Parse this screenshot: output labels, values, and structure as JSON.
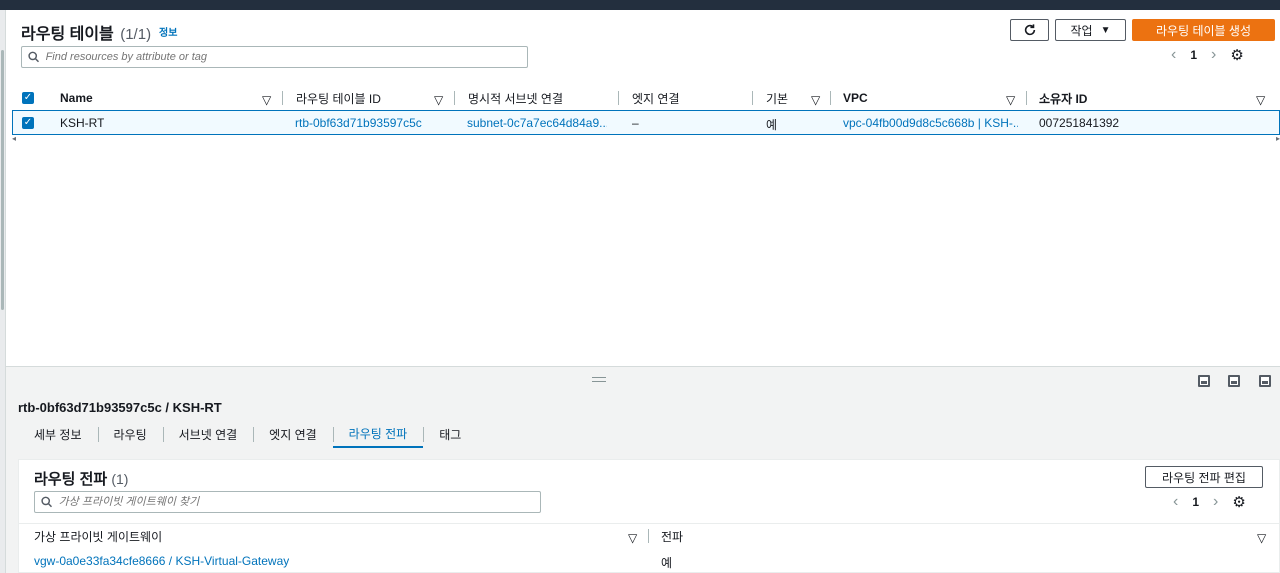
{
  "upper": {
    "title": "라우팅 테이블",
    "count": "(1/1)",
    "info": "정보",
    "actions_label": "작업",
    "create_label": "라우팅 테이블 생성",
    "search_placeholder": "Find resources by attribute or tag",
    "page": "1",
    "columns": [
      "Name",
      "라우팅 테이블 ID",
      "명시적 서브넷 연결",
      "엣지 연결",
      "기본",
      "VPC",
      "소유자 ID"
    ],
    "row": {
      "name": "KSH-RT",
      "rt_id": "rtb-0bf63d71b93597c5c",
      "subnet": "subnet-0c7a7ec64d84a9...",
      "edge": "–",
      "main": "예",
      "vpc": "vpc-04fb00d9d8c5c668b | KSH-...",
      "owner": "007251841392"
    }
  },
  "detail": {
    "title": "rtb-0bf63d71b93597c5c / KSH-RT",
    "tabs": [
      "세부 정보",
      "라우팅",
      "서브넷 연결",
      "엣지 연결",
      "라우팅 전파",
      "태그"
    ],
    "active_tab": "라우팅 전파"
  },
  "propagation": {
    "title": "라우팅 전파",
    "count": "(1)",
    "edit_label": "라우팅 전파 편집",
    "search_placeholder": "가상 프라이빗 게이트웨이 찾기",
    "page": "1",
    "columns": [
      "가상 프라이빗 게이트웨이",
      "전파"
    ],
    "row": {
      "gateway": "vgw-0a0e33fa34cfe8666 / KSH-Virtual-Gateway",
      "propagate": "예"
    }
  },
  "colors": {
    "accent": "#0073bb",
    "primary_button": "#ec7211",
    "topbar": "#232f3e"
  }
}
